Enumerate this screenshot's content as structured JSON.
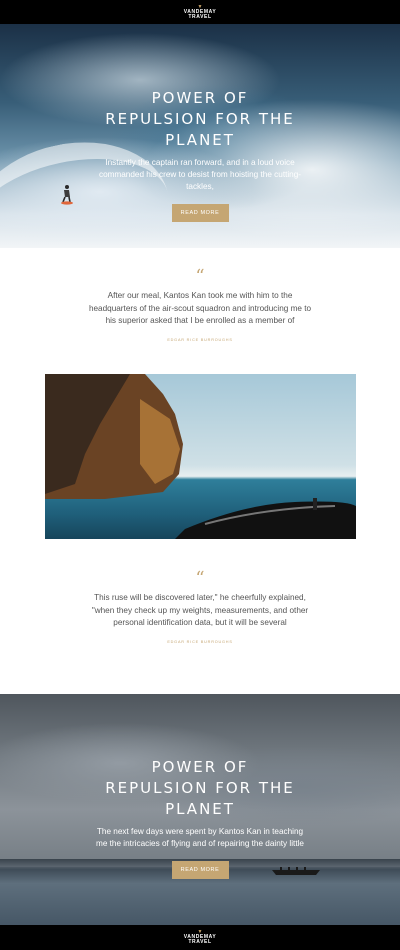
{
  "brand": {
    "name_line1": "VANDEMAY",
    "name_line2": "TRAVEL"
  },
  "hero1": {
    "title": "POWER OF REPULSION FOR THE PLANET",
    "text": "Instantly the captain ran forward, and in a loud voice commanded his crew to desist from hoisting the cutting-tackles,",
    "button": "READ MORE"
  },
  "quote1": {
    "mark": "“",
    "text": "After our meal, Kantos Kan took me with him to the headquarters of the air-scout squadron and introducing me to his superior asked that I be enrolled as a member of",
    "author": "EDGAR RICE BURROUGHS"
  },
  "quote2": {
    "mark": "“",
    "text": "This ruse will be discovered later,\" he cheerfully explained, \"when they check up my weights, measurements, and other personal identification data, but it will be several",
    "author": "EDGAR RICE BURROUGHS"
  },
  "hero2": {
    "title": "POWER OF REPULSION FOR THE PLANET",
    "text": "The next few days were spent by Kantos Kan in teaching me the intricacies of flying and of repairing the dainty little",
    "button": "READ MORE"
  },
  "colors": {
    "accent": "#c5a673",
    "bar": "#000000"
  }
}
